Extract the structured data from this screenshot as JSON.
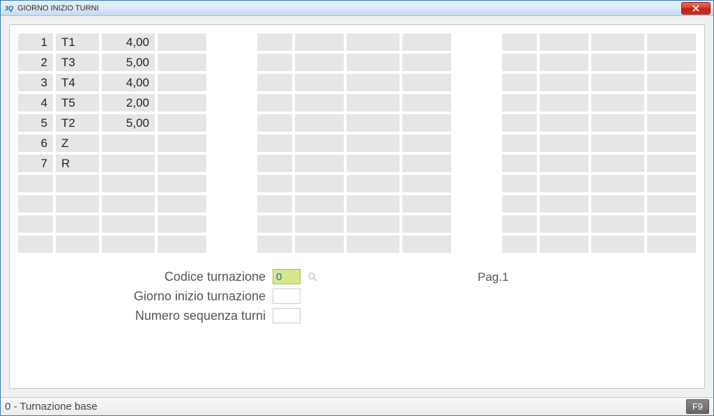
{
  "window": {
    "title": "GIORNO INIZIO TURNI"
  },
  "grid1": {
    "rows": [
      {
        "num": "1",
        "code": "T1",
        "val": "4,00"
      },
      {
        "num": "2",
        "code": "T3",
        "val": "5,00"
      },
      {
        "num": "3",
        "code": "T4",
        "val": "4,00"
      },
      {
        "num": "4",
        "code": "T5",
        "val": "2,00"
      },
      {
        "num": "5",
        "code": "T2",
        "val": "5,00"
      },
      {
        "num": "6",
        "code": "Z",
        "val": ""
      },
      {
        "num": "7",
        "code": "R",
        "val": ""
      }
    ],
    "total_rows": 11
  },
  "grid2": {
    "total_rows": 11
  },
  "grid3": {
    "total_rows": 11
  },
  "form": {
    "labels": {
      "codice": "Codice turnazione",
      "giorno": "Giorno inizio turnazione",
      "numero": "Numero sequenza turni"
    },
    "values": {
      "codice": "0",
      "giorno": "",
      "numero": ""
    },
    "page": "Pag.1"
  },
  "statusbar": {
    "text": "0 - Turnazione base",
    "button": "F9"
  }
}
